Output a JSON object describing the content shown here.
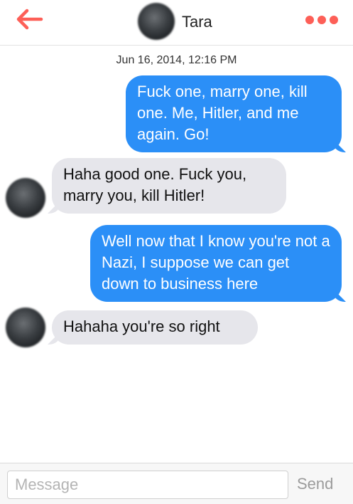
{
  "header": {
    "contact_name": "Tara",
    "back_icon": "back-arrow-icon",
    "more_icon": "more-dots-icon",
    "accent_color": "#fd5f57"
  },
  "conversation": {
    "timestamp": "Jun 16, 2014, 12:16 PM",
    "messages": [
      {
        "direction": "outgoing",
        "text": "Fuck one, marry one, kill one. Me, Hitler, and me again. Go!"
      },
      {
        "direction": "incoming",
        "text": "Haha good one. Fuck you, marry you, kill Hitler!"
      },
      {
        "direction": "outgoing",
        "text": "Well now that I know you're not a Nazi, I suppose we can get down to business here"
      },
      {
        "direction": "incoming",
        "text": "Hahaha you're so right"
      }
    ],
    "outgoing_color": "#2b8ff7",
    "incoming_color": "#e6e6eb"
  },
  "composer": {
    "placeholder": "Message",
    "send_label": "Send"
  }
}
